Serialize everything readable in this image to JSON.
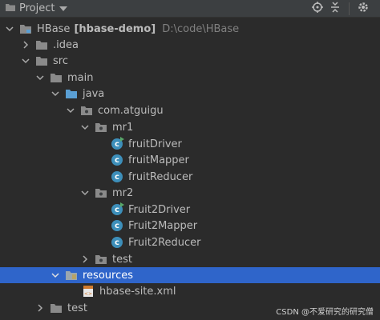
{
  "toolbar": {
    "project_label": "Project",
    "icons": [
      "project-folder-icon",
      "chevron-down-icon",
      "locate-icon",
      "collapse-all-icon",
      "gear-icon"
    ]
  },
  "tree": {
    "root": {
      "name": "HBase",
      "module": "[hbase-demo]",
      "path": "D:\\code\\HBase"
    },
    "idea": ".idea",
    "src": "src",
    "main": "main",
    "java": "java",
    "package": "com.atguigu",
    "mr1": {
      "name": "mr1",
      "classes": [
        "fruitDriver",
        "fruitMapper",
        "fruitReducer"
      ]
    },
    "mr2": {
      "name": "mr2",
      "classes": [
        "Fruit2Driver",
        "Fruit2Mapper",
        "Fruit2Reducer"
      ]
    },
    "test_pkg": "test",
    "resources": "resources",
    "hbase_site": "hbase-site.xml",
    "test_dir": "test"
  },
  "colors": {
    "background": "#2b2b2b",
    "selection": "#2f65ca",
    "class_icon": "#3d8fba",
    "folder": "#8a8a8a",
    "source_folder": "#5a9fd4"
  },
  "watermark": "CSDN @不爱研究的研究僧"
}
